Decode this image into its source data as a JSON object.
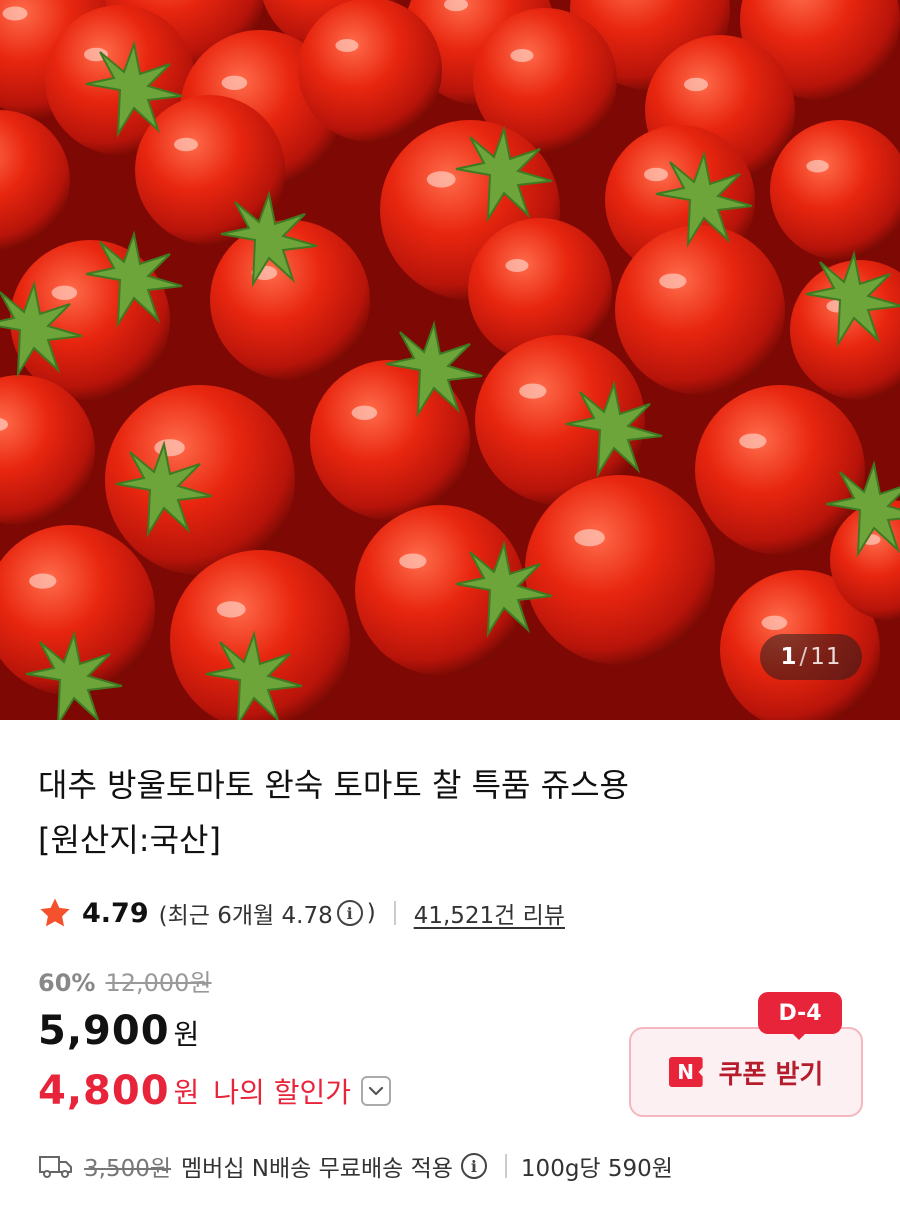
{
  "gallery": {
    "current": "1",
    "separator": "/",
    "total": "11"
  },
  "product": {
    "title_line1": "대추 방울토마토 완숙 토마토 찰 특품 쥬스용",
    "title_line2": "[원산지:국산]"
  },
  "rating": {
    "score": "4.79",
    "recent_prefix": "(최근 6개월 4.78",
    "recent_suffix": ")",
    "reviews": "41,521건 리뷰"
  },
  "price": {
    "discount_rate": "60%",
    "original": "12,000원",
    "sale": "5,900",
    "sale_unit": "원",
    "my_price": "4,800",
    "my_unit": "원",
    "my_label": "나의 할인가"
  },
  "coupon": {
    "badge": "D-4",
    "brand_mark": "N",
    "label": "쿠폰 받기"
  },
  "shipping": {
    "fee": "3,500원",
    "description": "멤버십 N배송 무료배송 적용",
    "unit_price": "100g당 590원"
  },
  "colors": {
    "accent": "#e8243a",
    "star": "#f4512c",
    "coupon_bg": "#fdf0f2"
  }
}
